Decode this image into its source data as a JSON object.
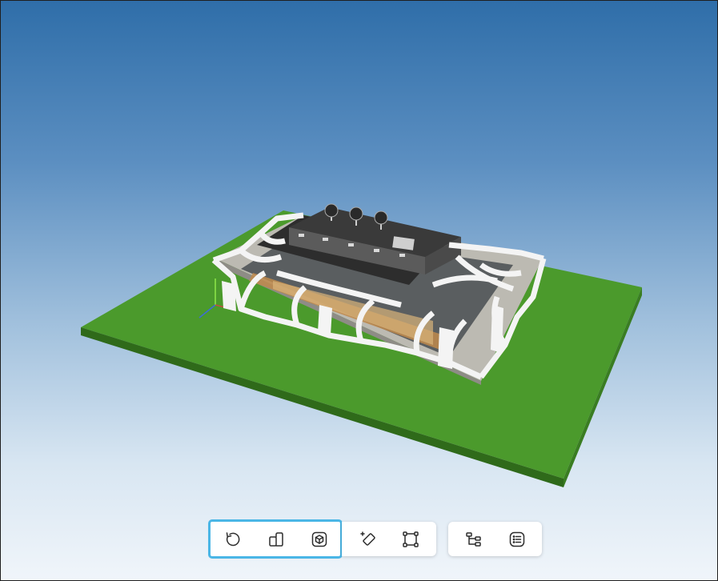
{
  "viewer": {
    "scene_description_hidden": "",
    "colors": {
      "sky_top": "#2f6ea9",
      "sky_bottom": "#f0f5fa",
      "ground": "#4b9a2c",
      "toolbar_highlight": "#4ab6e6"
    }
  },
  "toolbar": {
    "groups": [
      {
        "name": "navigation",
        "highlighted": true,
        "buttons": [
          {
            "icon": "rotate-icon",
            "label": ""
          },
          {
            "icon": "section-box-icon",
            "label": ""
          },
          {
            "icon": "view-cube-icon",
            "label": ""
          }
        ]
      },
      {
        "name": "tools",
        "highlighted": false,
        "buttons": [
          {
            "icon": "add-tag-icon",
            "label": ""
          },
          {
            "icon": "bounding-box-icon",
            "label": ""
          }
        ]
      },
      {
        "name": "panels",
        "highlighted": false,
        "buttons": [
          {
            "icon": "model-tree-icon",
            "label": ""
          },
          {
            "icon": "properties-list-icon",
            "label": ""
          }
        ]
      }
    ]
  }
}
